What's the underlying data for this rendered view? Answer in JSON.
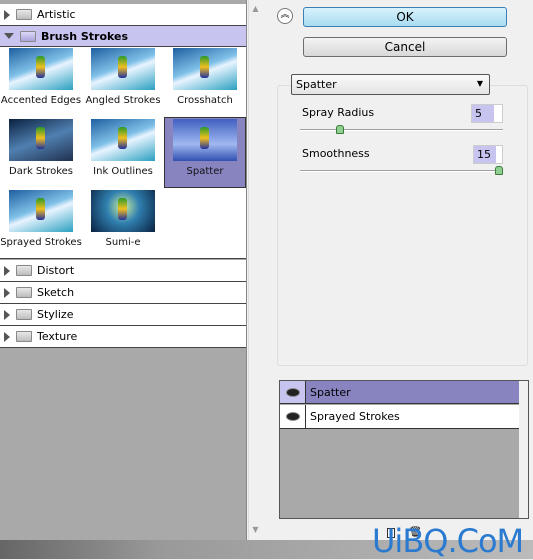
{
  "categories_top": [
    {
      "label": "Artistic",
      "expanded": false
    },
    {
      "label": "Brush Strokes",
      "expanded": true
    }
  ],
  "filters": [
    "Accented Edges",
    "Angled Strokes",
    "Crosshatch",
    "Dark Strokes",
    "Ink Outlines",
    "Spatter",
    "Sprayed Strokes",
    "Sumi-e"
  ],
  "selected_filter": "Spatter",
  "categories_bottom": [
    "Distort",
    "Sketch",
    "Stylize",
    "Texture"
  ],
  "buttons": {
    "ok": "OK",
    "cancel": "Cancel"
  },
  "filter_select": "Spatter",
  "params": [
    {
      "label": "Spray Radius",
      "value": "5",
      "fraction": 0.2
    },
    {
      "label": "Smoothness",
      "value": "15",
      "fraction": 1.0
    }
  ],
  "layers": [
    {
      "label": "Spatter",
      "selected": true
    },
    {
      "label": "Sprayed Strokes",
      "selected": false
    }
  ],
  "watermark": "UiBQ.CoM",
  "colors": {
    "selection": "#8884c0",
    "header": "#c8c4f0",
    "ok_button": "#bfe6f7"
  }
}
